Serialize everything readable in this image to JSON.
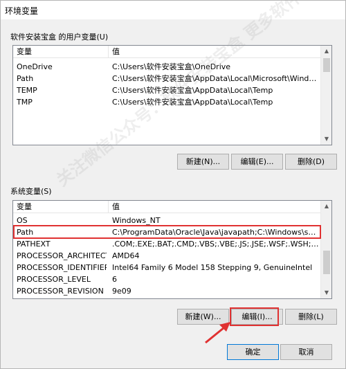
{
  "window": {
    "title": "环境变量"
  },
  "user_section": {
    "label": "软件安装宝盒 的用户变量(U)",
    "columns": [
      "变量",
      "值"
    ],
    "rows": [
      {
        "name": "OneDrive",
        "value": "C:\\Users\\软件安装宝盒\\OneDrive"
      },
      {
        "name": "Path",
        "value": "C:\\Users\\软件安装宝盒\\AppData\\Local\\Microsoft\\WindowsAp..."
      },
      {
        "name": "TEMP",
        "value": "C:\\Users\\软件安装宝盒\\AppData\\Local\\Temp"
      },
      {
        "name": "TMP",
        "value": "C:\\Users\\软件安装宝盒\\AppData\\Local\\Temp"
      }
    ],
    "buttons": {
      "new": "新建(N)...",
      "edit": "编辑(E)...",
      "delete": "删除(D)"
    }
  },
  "system_section": {
    "label": "系统变量(S)",
    "columns": [
      "变量",
      "值"
    ],
    "rows": [
      {
        "name": "OS",
        "value": "Windows_NT"
      },
      {
        "name": "Path",
        "value": "C:\\ProgramData\\Oracle\\Java\\javapath;C:\\Windows\\system32;..."
      },
      {
        "name": "PATHEXT",
        "value": ".COM;.EXE;.BAT;.CMD;.VBS;.VBE;.JS;.JSE;.WSF;.WSH;.MSC"
      },
      {
        "name": "PROCESSOR_ARCHITECT...",
        "value": "AMD64"
      },
      {
        "name": "PROCESSOR_IDENTIFIER",
        "value": "Intel64 Family 6 Model 158 Stepping 9, GenuineIntel"
      },
      {
        "name": "PROCESSOR_LEVEL",
        "value": "6"
      },
      {
        "name": "PROCESSOR_REVISION",
        "value": "9e09"
      }
    ],
    "buttons": {
      "new": "新建(W)...",
      "edit": "编辑(I)...",
      "delete": "删除(L)"
    }
  },
  "footer": {
    "ok": "确定",
    "cancel": "取消"
  },
  "watermark": "关注微信公众号：软件安装宝盒 更多软件等你来下载",
  "colors": {
    "highlight": "#e03131",
    "accent": "#0078d7"
  }
}
